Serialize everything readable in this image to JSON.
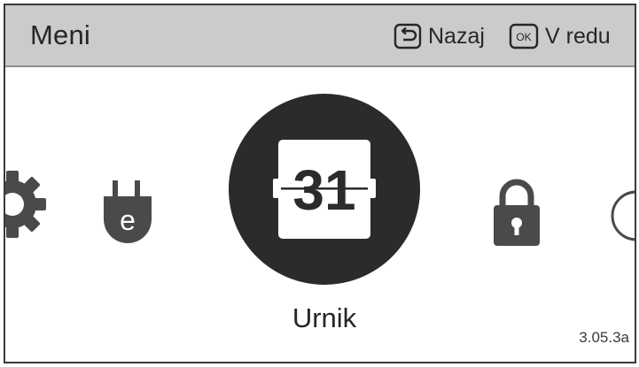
{
  "header": {
    "title": "Meni",
    "back_label": "Nazaj",
    "ok_label": "V redu",
    "ok_key_text": "OK"
  },
  "menu": {
    "items": [
      {
        "icon": "gear-icon"
      },
      {
        "icon": "energy-plug-icon",
        "glyph": "e"
      },
      {
        "icon": "calendar-flip-icon",
        "glyph": "31",
        "selected": true
      },
      {
        "icon": "lock-icon"
      },
      {
        "icon": "clock-icon"
      }
    ],
    "selected_label": "Urnik"
  },
  "footer": {
    "version": "3.05.3a"
  }
}
